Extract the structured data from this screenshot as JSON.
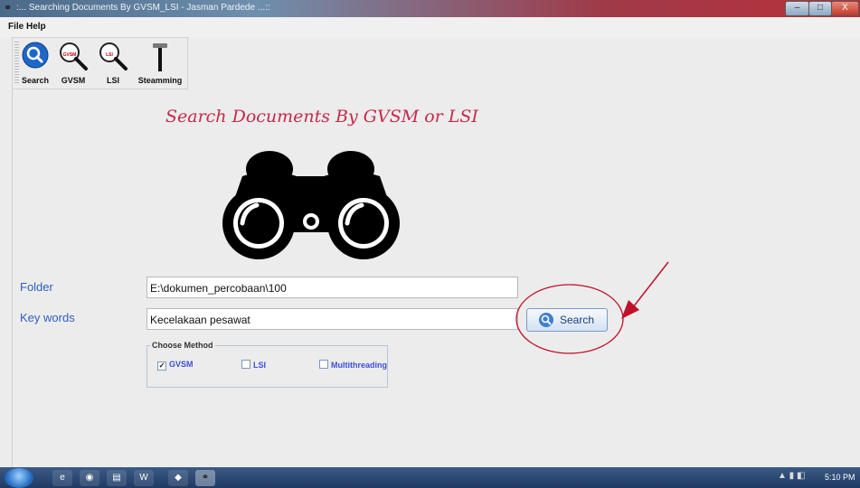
{
  "window": {
    "title": ":... Searching Documents By GVSM_LSI - Jasman Pardede ...::",
    "minimize_glyph": "–",
    "maximize_glyph": "□",
    "close_glyph": "X"
  },
  "menu": {
    "items": [
      "File",
      "Help"
    ]
  },
  "toolbar": {
    "buttons": [
      {
        "label": "Search",
        "icon": "search-icon"
      },
      {
        "label": "GVSM",
        "icon": "magnifier-gvsm-icon",
        "badge": "GVSM"
      },
      {
        "label": "LSI",
        "icon": "magnifier-lsi-icon",
        "badge": "LSI"
      },
      {
        "label": "Steamming",
        "icon": "hammer-icon"
      }
    ]
  },
  "main": {
    "headline": "Search Documents By GVSM or LSI",
    "folder_label": "Folder",
    "folder_value": "E:\\dokumen_percobaan\\100",
    "keywords_label": "Key words",
    "keywords_value": "Kecelakaan pesawat",
    "search_button": "Search",
    "method": {
      "legend": "Choose Method",
      "options": [
        {
          "label": "GVSM",
          "checked": true
        },
        {
          "label": "LSI",
          "checked": false
        },
        {
          "label": "Multithreading",
          "checked": false
        }
      ]
    }
  },
  "taskbar": {
    "time": "5:10 PM",
    "word_icon": "W"
  },
  "colors": {
    "accent_red": "#c42a4a",
    "label_blue": "#2d5fc4",
    "annotation_red": "#c0102a"
  }
}
